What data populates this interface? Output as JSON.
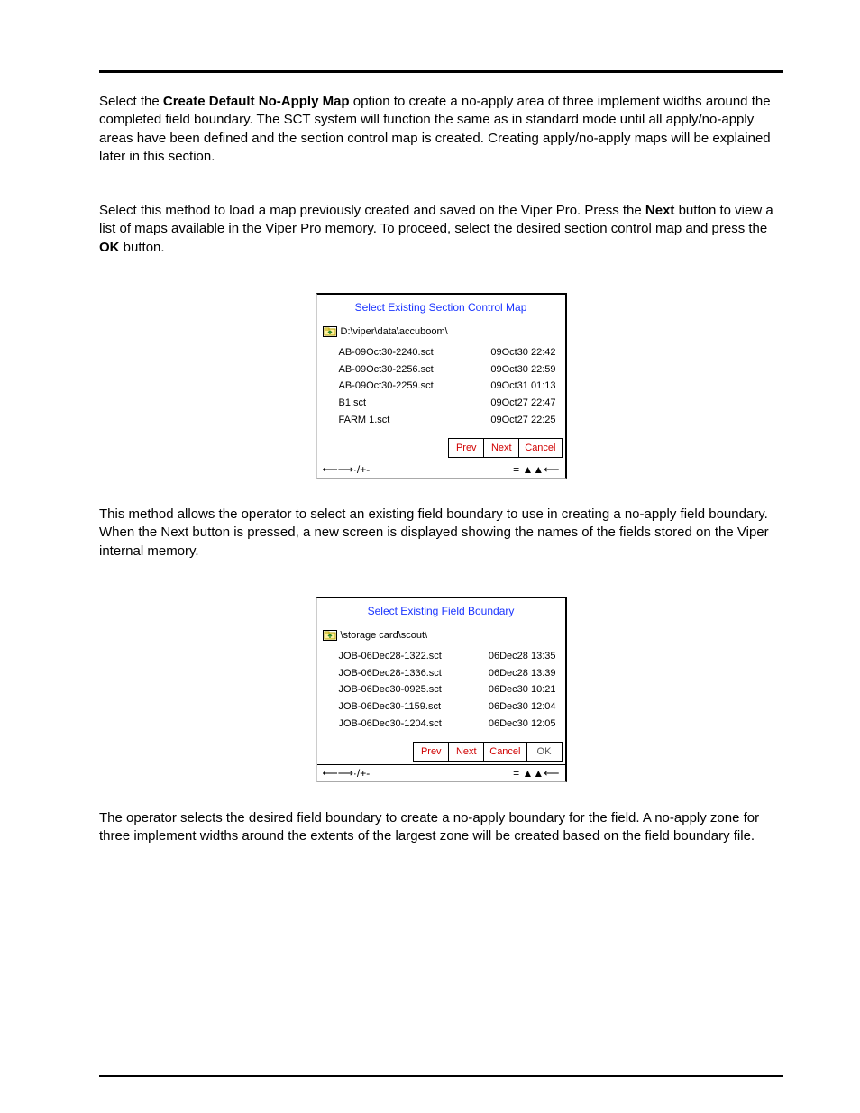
{
  "para1_pre": "Select the ",
  "para1_bold": "Create Default No-Apply Map",
  "para1_post": " option to create a no-apply area of three implement widths around the completed field boundary. The SCT system will function the same as in standard mode until all apply/no-apply areas have been defined and the section control map is created. Creating apply/no-apply maps will be explained later in this section.",
  "para2_a": "Select this method to load a map previously created and saved on the Viper Pro. Press the ",
  "para2_b_bold": "Next",
  "para2_c": " button to view a list of maps available in the Viper Pro memory. To proceed, select the desired section control map and press the ",
  "para2_d_bold": "OK",
  "para2_e": " button.",
  "panel1": {
    "title": "Select Existing Section Control Map",
    "path": "D:\\viper\\data\\accuboom\\",
    "files": [
      {
        "name": "AB-09Oct30-2240.sct",
        "time": "09Oct30 22:42"
      },
      {
        "name": "AB-09Oct30-2256.sct",
        "time": "09Oct30 22:59"
      },
      {
        "name": "AB-09Oct30-2259.sct",
        "time": "09Oct31 01:13"
      },
      {
        "name": "B1.sct",
        "time": "09Oct27 22:47"
      },
      {
        "name": "FARM 1.sct",
        "time": "09Oct27 22:25"
      }
    ],
    "buttons": {
      "prev": "Prev",
      "next": "Next",
      "cancel": "Cancel"
    }
  },
  "para3": "This method allows the operator to select an existing field boundary to use in creating a no-apply field boundary. When the Next button is pressed, a new screen is displayed showing the names of the fields stored on the Viper internal memory.",
  "panel2": {
    "title": "Select Existing Field Boundary",
    "path": "\\storage card\\scout\\",
    "files": [
      {
        "name": "JOB-06Dec28-1322.sct",
        "time": "06Dec28 13:35"
      },
      {
        "name": "JOB-06Dec28-1336.sct",
        "time": "06Dec28 13:39"
      },
      {
        "name": "JOB-06Dec30-0925.sct",
        "time": "06Dec30 10:21"
      },
      {
        "name": "JOB-06Dec30-1159.sct",
        "time": "06Dec30 12:04"
      },
      {
        "name": "JOB-06Dec30-1204.sct",
        "time": "06Dec30 12:05"
      }
    ],
    "buttons": {
      "prev": "Prev",
      "next": "Next",
      "cancel": "Cancel",
      "ok": "OK"
    }
  },
  "para4": "The operator selects the desired field boundary to create a no-apply boundary for the field. A no-apply zone for three implement widths around the extents of the largest zone will be created based on the field boundary file."
}
